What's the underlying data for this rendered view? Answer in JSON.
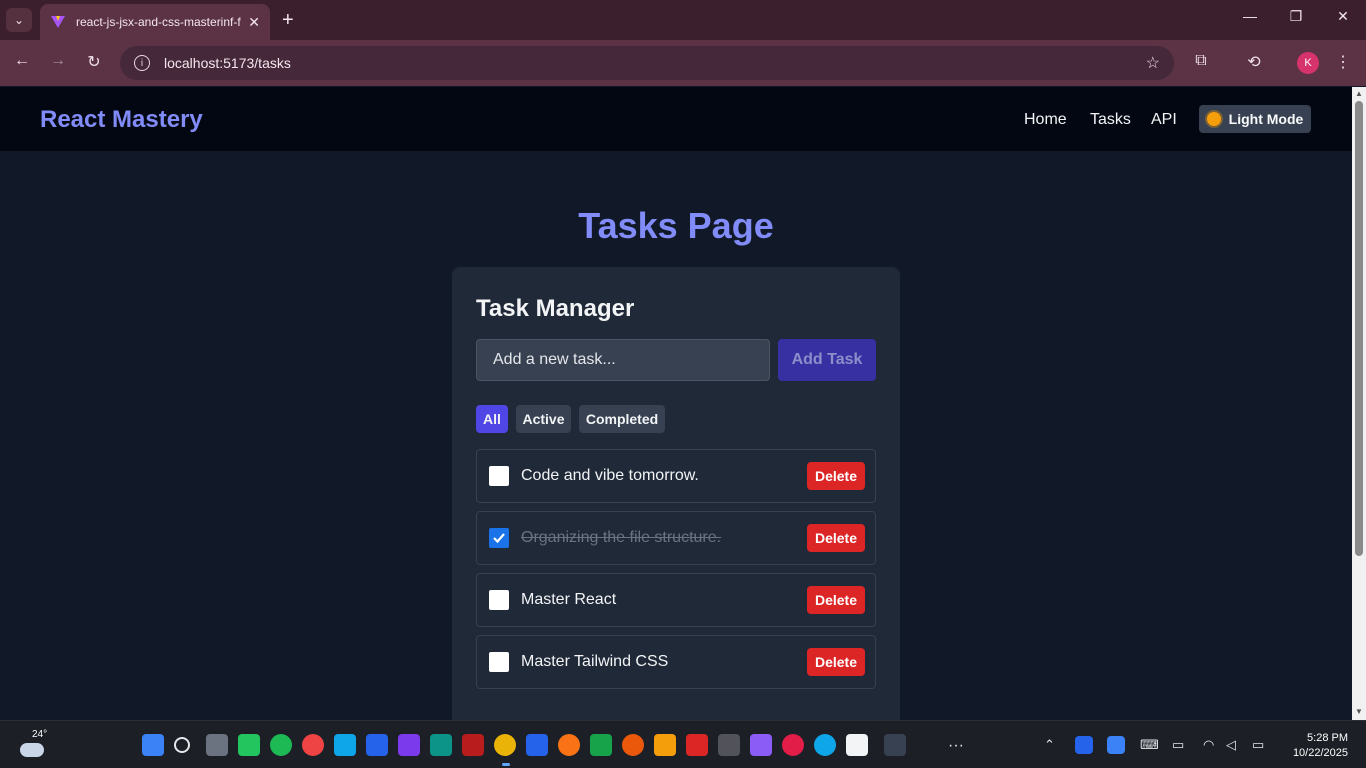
{
  "browser": {
    "tab_title": "react-js-jsx-and-css-masterinf-f",
    "url": "localhost:5173/tasks",
    "profile_initial": "K"
  },
  "app": {
    "brand": "React Mastery",
    "nav": [
      "Home",
      "Tasks",
      "API"
    ],
    "theme_toggle": "Light Mode",
    "page_title": "Tasks Page",
    "card_title": "Task Manager",
    "input_placeholder": "Add a new task...",
    "add_button": "Add Task",
    "filters": [
      {
        "label": "All",
        "active": true
      },
      {
        "label": "Active",
        "active": false
      },
      {
        "label": "Completed",
        "active": false
      }
    ],
    "tasks": [
      {
        "text": "Code and vibe tomorrow.",
        "completed": false,
        "delete_label": "Delete"
      },
      {
        "text": "Organizing the file structure.",
        "completed": true,
        "delete_label": "Delete"
      },
      {
        "text": "Master React",
        "completed": false,
        "delete_label": "Delete"
      },
      {
        "text": "Master Tailwind CSS",
        "completed": false,
        "delete_label": "Delete"
      }
    ]
  },
  "taskbar": {
    "temperature": "24°",
    "time": "5:28 PM",
    "date": "10/22/2025"
  },
  "colors": {
    "accent": "#818cf8",
    "primary_button": "#4f46e5",
    "danger": "#dc2626",
    "background": "#111827",
    "card": "#1f2937"
  }
}
